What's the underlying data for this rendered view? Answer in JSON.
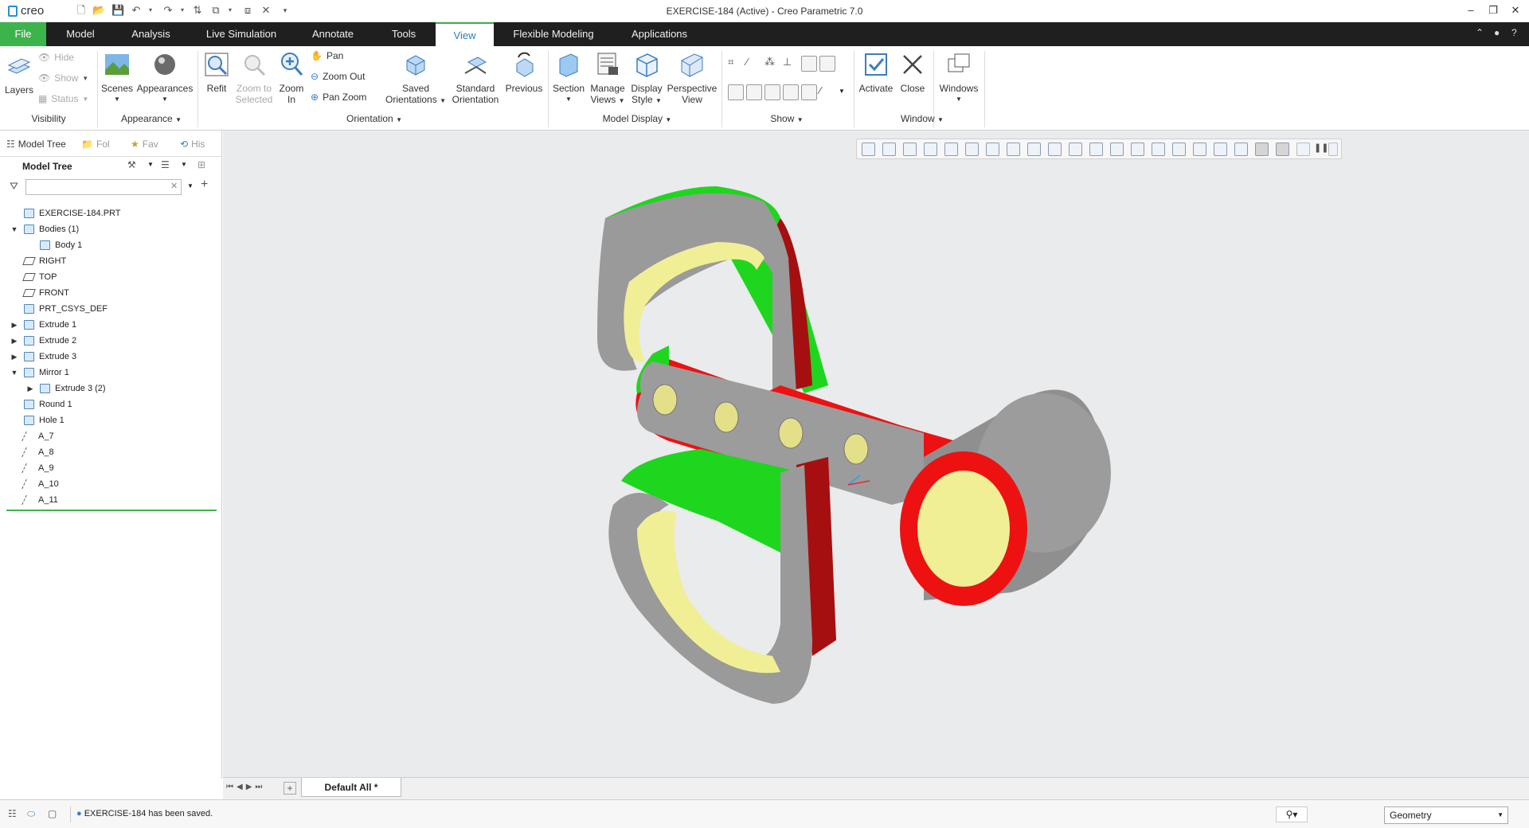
{
  "app": {
    "logo": "creo",
    "window_title": "EXERCISE-184 (Active) - Creo Parametric 7.0"
  },
  "menu": {
    "tabs": [
      "File",
      "Model",
      "Analysis",
      "Live Simulation",
      "Annotate",
      "Tools",
      "View",
      "Flexible Modeling",
      "Applications"
    ],
    "active": "View"
  },
  "ribbon": {
    "visibility": {
      "layers": "Layers",
      "hide": "Hide",
      "show": "Show",
      "status": "Status",
      "group": "Visibility"
    },
    "appearance": {
      "scenes": "Scenes",
      "appearances": "Appearances",
      "group": "Appearance"
    },
    "orientation": {
      "refit": "Refit",
      "zoom_to_selected_1": "Zoom to",
      "zoom_to_selected_2": "Selected",
      "zoom_in_1": "Zoom",
      "zoom_in_2": "In",
      "pan": "Pan",
      "zoom_out": "Zoom Out",
      "pan_zoom": "Pan Zoom",
      "saved_1": "Saved",
      "saved_2": "Orientations",
      "standard_1": "Standard",
      "standard_2": "Orientation",
      "previous": "Previous",
      "group": "Orientation"
    },
    "model_display": {
      "section": "Section",
      "manage_1": "Manage",
      "manage_2": "Views",
      "display_1": "Display",
      "display_2": "Style",
      "perspective_1": "Perspective",
      "perspective_2": "View",
      "group": "Model Display"
    },
    "show": {
      "group": "Show"
    },
    "window": {
      "activate": "Activate",
      "close": "Close",
      "windows": "Windows",
      "group": "Window"
    }
  },
  "panel": {
    "tabs": [
      "Model Tree",
      "Fol",
      "Fav",
      "His"
    ],
    "title": "Model Tree"
  },
  "tree": [
    {
      "label": "EXERCISE-184.PRT",
      "indent": 0,
      "icon": "part",
      "exp": ""
    },
    {
      "label": "Bodies (1)",
      "indent": 0,
      "icon": "body",
      "exp": "▼"
    },
    {
      "label": "Body 1",
      "indent": 1,
      "icon": "body",
      "exp": ""
    },
    {
      "label": "RIGHT",
      "indent": 0,
      "icon": "plane",
      "exp": ""
    },
    {
      "label": "TOP",
      "indent": 0,
      "icon": "plane",
      "exp": ""
    },
    {
      "label": "FRONT",
      "indent": 0,
      "icon": "plane",
      "exp": ""
    },
    {
      "label": "PRT_CSYS_DEF",
      "indent": 0,
      "icon": "csys",
      "exp": ""
    },
    {
      "label": "Extrude 1",
      "indent": 0,
      "icon": "extrude",
      "exp": "▶"
    },
    {
      "label": "Extrude 2",
      "indent": 0,
      "icon": "extrude",
      "exp": "▶"
    },
    {
      "label": "Extrude 3",
      "indent": 0,
      "icon": "extrude",
      "exp": "▶"
    },
    {
      "label": "Mirror 1",
      "indent": 0,
      "icon": "mirror",
      "exp": "▼"
    },
    {
      "label": "Extrude 3 (2)",
      "indent": 1,
      "icon": "extrude",
      "exp": "▶"
    },
    {
      "label": "Round 1",
      "indent": 0,
      "icon": "round",
      "exp": ""
    },
    {
      "label": "Hole 1",
      "indent": 0,
      "icon": "hole",
      "exp": ""
    },
    {
      "label": "A_7",
      "indent": 0,
      "icon": "axis",
      "exp": ""
    },
    {
      "label": "A_8",
      "indent": 0,
      "icon": "axis",
      "exp": ""
    },
    {
      "label": "A_9",
      "indent": 0,
      "icon": "axis",
      "exp": ""
    },
    {
      "label": "A_10",
      "indent": 0,
      "icon": "axis",
      "exp": ""
    },
    {
      "label": "A_11",
      "indent": 0,
      "icon": "axis",
      "exp": ""
    }
  ],
  "bottom": {
    "tab": "Default All *"
  },
  "status": {
    "message": "EXERCISE-184 has been saved.",
    "filter": "Geometry"
  },
  "colors": {
    "accent_green": "#3cb44b",
    "menubar": "#1f1f1f",
    "face_green": "#22dd22",
    "face_red": "#ee1111",
    "face_yellow": "#f5f29a",
    "face_gray": "#9a9a9a"
  }
}
